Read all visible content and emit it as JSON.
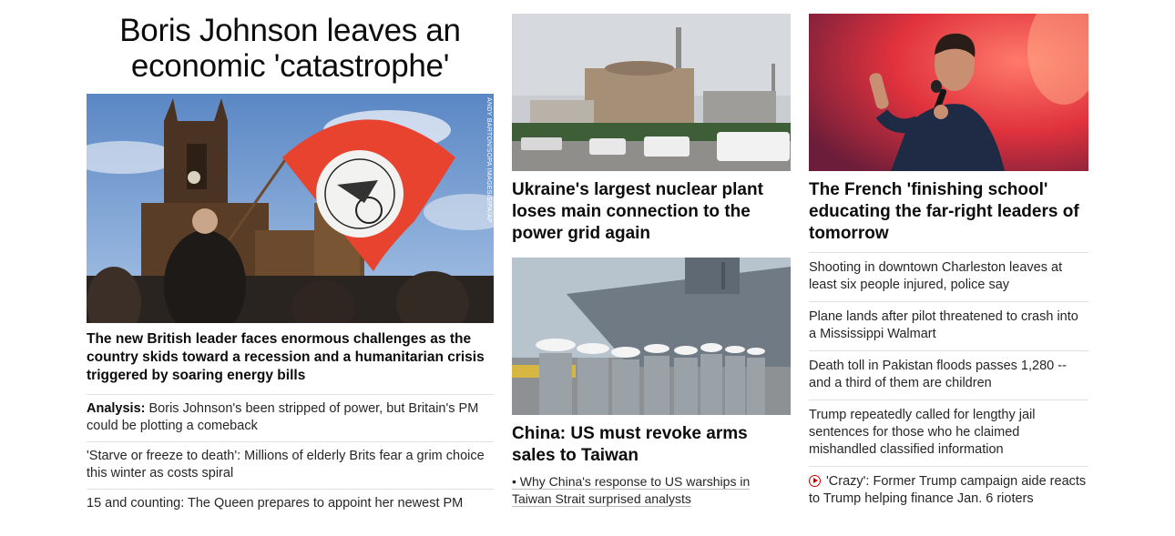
{
  "lead": {
    "headline": "Boris Johnson leaves an economic 'catastrophe'",
    "image_credit": "ANDY BARTON/SOPA IMAGES/SIPA/AP",
    "description": "The new British leader faces enormous challenges as the country skids toward a recession and a humanitarian crisis triggered by soaring energy bills",
    "related": [
      {
        "prefix": "Analysis:",
        "text": " Boris Johnson's been stripped of power, but Britain's PM could be plotting a comeback"
      },
      {
        "prefix": "",
        "text": "'Starve or freeze to death': Millions of elderly Brits fear a grim choice this winter as costs spiral"
      },
      {
        "prefix": "",
        "text": "15 and counting: The Queen prepares to appoint her newest PM"
      }
    ]
  },
  "middle": {
    "card1": {
      "headline": "Ukraine's largest nuclear plant loses main connection to the power grid again"
    },
    "card2": {
      "headline": "China: US must revoke arms sales to Taiwan",
      "sublink": "• Why China's response to US warships in Taiwan Strait surprised analysts"
    }
  },
  "right": {
    "card": {
      "headline": "The French 'finishing school' educating the far-right leaders of tomorrow"
    },
    "links": [
      {
        "text": "Shooting in downtown Charleston leaves at least six people injured, police say",
        "video": false
      },
      {
        "text": "Plane lands after pilot threatened to crash into a Mississippi Walmart",
        "video": false
      },
      {
        "text": "Death toll in Pakistan floods passes 1,280 -- and a third of them are children",
        "video": false
      },
      {
        "text": "Trump repeatedly called for lengthy jail sentences for those who he claimed mishandled classified information",
        "video": false
      },
      {
        "text": "'Crazy': Former Trump campaign aide reacts to Trump helping finance Jan. 6 rioters",
        "video": true
      }
    ]
  },
  "colors": {
    "accent": "#cc0000",
    "text": "#0c0c0c",
    "divider": "#e0e0e0"
  }
}
